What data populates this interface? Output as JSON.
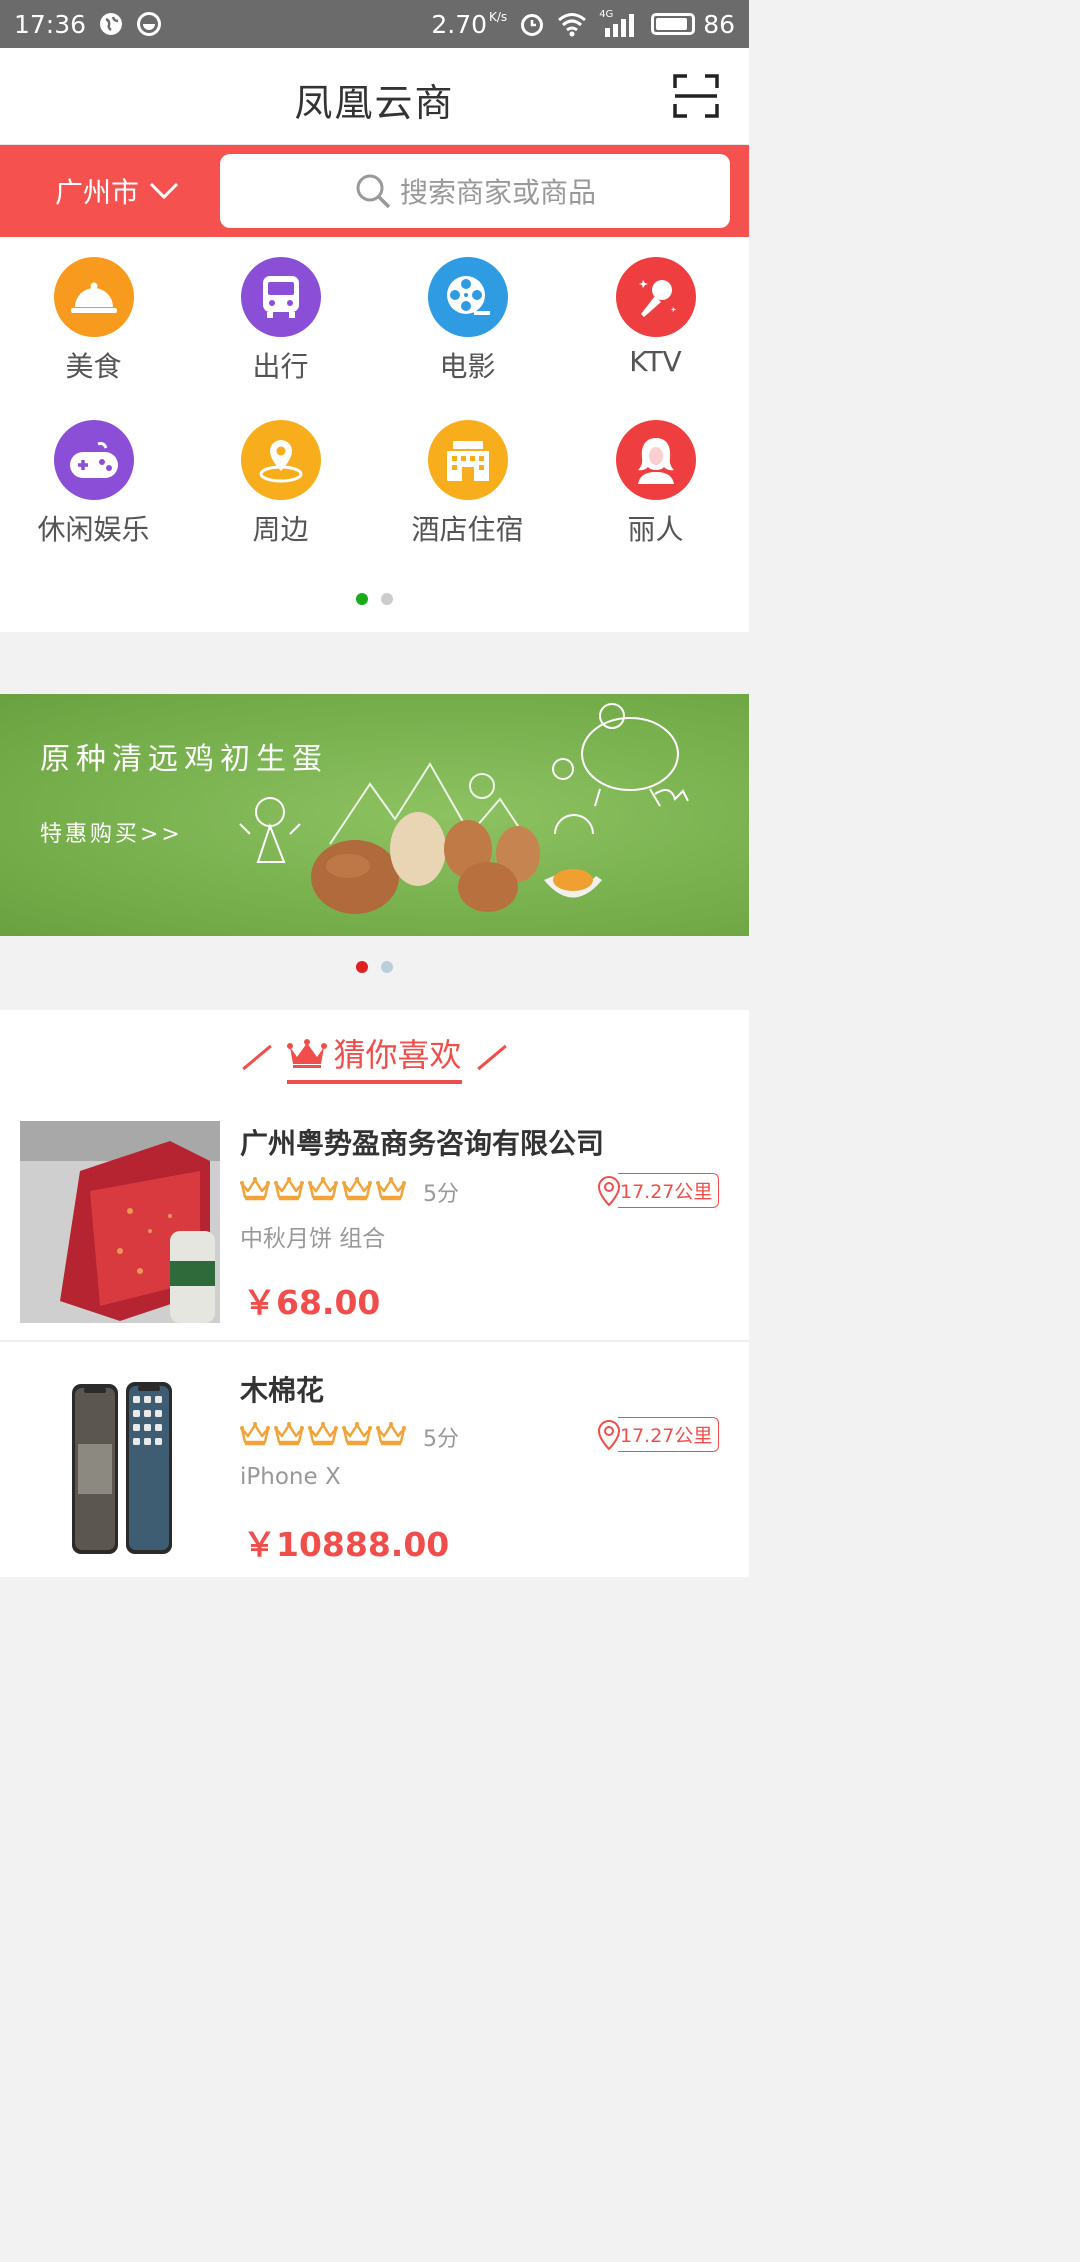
{
  "status_bar": {
    "time": "17:36",
    "network_speed": "2.70",
    "network_unit": "K/s",
    "signal_type": "4G",
    "battery_level": "86",
    "battery_fraction": 0.86
  },
  "header": {
    "title": "凤凰云商",
    "scan_icon": "scan-icon"
  },
  "search": {
    "city": "广州市",
    "placeholder": "搜索商家或商品"
  },
  "categories": [
    {
      "label": "美食",
      "icon": "food-cover-icon",
      "color": "#f79a1d"
    },
    {
      "label": "出行",
      "icon": "bus-icon",
      "color": "#8a4fd6"
    },
    {
      "label": "电影",
      "icon": "film-reel-icon",
      "color": "#2e9be3"
    },
    {
      "label": "KTV",
      "icon": "microphone-icon",
      "color": "#ef3e40"
    },
    {
      "label": "休闲娱乐",
      "icon": "gamepad-icon",
      "color": "#8a4fd6"
    },
    {
      "label": "周边",
      "icon": "location-pin-icon",
      "color": "#f7ad1c"
    },
    {
      "label": "酒店住宿",
      "icon": "hotel-icon",
      "color": "#f7ad1c"
    },
    {
      "label": "丽人",
      "icon": "woman-icon",
      "color": "#ef3e40"
    }
  ],
  "category_pager": {
    "active_index": 0,
    "count": 2,
    "active_color": "#1aab1a"
  },
  "banner": {
    "title": "原种清远鸡初生蛋",
    "subtitle": "特惠购买>>",
    "pager": {
      "active_index": 0,
      "count": 2,
      "active_color": "#e02020",
      "inactive_color": "#b9cfdc"
    }
  },
  "recommend": {
    "title": "猜你喜欢",
    "items": [
      {
        "name": "广州粤势盈商务咨询有限公司",
        "rating": 5,
        "score_text": "5分",
        "distance": "17.27公里",
        "description": "中秋月饼 组合",
        "price": "￥68.00"
      },
      {
        "name": "木棉花",
        "rating": 5,
        "score_text": "5分",
        "distance": "17.27公里",
        "description": "iPhone X",
        "price": "￥10888.00"
      }
    ]
  },
  "colors": {
    "brand_red": "#f5514f",
    "price_red": "#f04e4c",
    "star_gold": "#f0a43a"
  }
}
